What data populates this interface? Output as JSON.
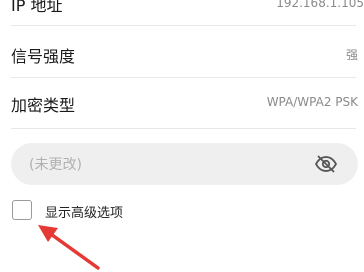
{
  "rows": {
    "ip": {
      "label": "IP 地址",
      "value": "192.168.1.105"
    },
    "signal": {
      "label": "信号强度",
      "value": "强"
    },
    "encryption": {
      "label": "加密类型",
      "value": "WPA/WPA2 PSK"
    }
  },
  "password": {
    "placeholder": "(未更改)",
    "icon": "eye-off-icon"
  },
  "advanced": {
    "label": "显示高级选项",
    "checked": false
  },
  "annotation": {
    "icon": "red-arrow",
    "color": "#e53935"
  }
}
